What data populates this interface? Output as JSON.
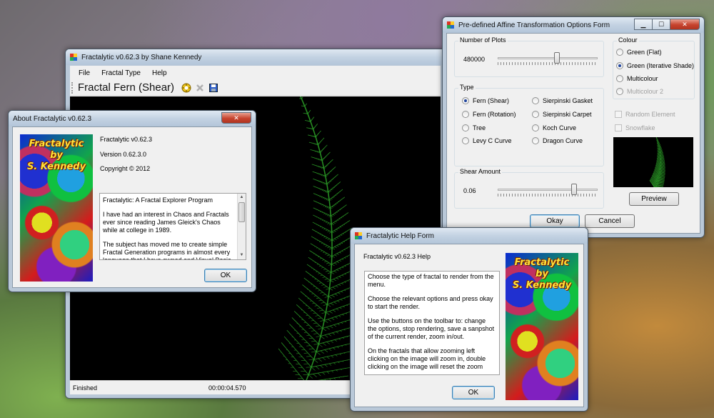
{
  "main_window": {
    "title": "Fractalytic v0.62.3 by Shane Kennedy",
    "menu": [
      "File",
      "Fractal Type",
      "Help"
    ],
    "fractal_label": "Fractal Fern (Shear)",
    "toolbar_icons": [
      "options-icon",
      "stop-icon",
      "save-icon"
    ],
    "status": {
      "left": "Finished",
      "time": "00:00:04.570"
    }
  },
  "about_window": {
    "title": "About Fractalytic v0.62.3",
    "image_caption": [
      "Fractalytic",
      "by",
      "S. Kennedy"
    ],
    "product": "Fractalytic v0.62.3",
    "version": "Version 0.62.3.0",
    "copyright": "Copyright © 2012",
    "description": [
      "Fractalytic: A Fractal Explorer Program",
      "I have had an interest in Chaos and Fractals ever since reading James Gleick's Chaos while at college in 1989.",
      "The subject has moved me to create simple Fractal Generation programs in almost every language that I have owned and Visual Basic is"
    ],
    "ok_label": "OK"
  },
  "options_window": {
    "title": "Pre-defined Affine Transformation Options Form",
    "plots": {
      "legend": "Number of Plots",
      "value": "480000",
      "level": 0.6
    },
    "type": {
      "legend": "Type",
      "options": [
        {
          "label": "Fern (Shear)",
          "selected": true
        },
        {
          "label": "Sierpinski Gasket",
          "selected": false
        },
        {
          "label": "Fern (Rotation)",
          "selected": false
        },
        {
          "label": "Sierpinski Carpet",
          "selected": false
        },
        {
          "label": "Tree",
          "selected": false
        },
        {
          "label": "Koch Curve",
          "selected": false
        },
        {
          "label": "Levy C Curve",
          "selected": false
        },
        {
          "label": "Dragon Curve",
          "selected": false
        }
      ]
    },
    "shear": {
      "legend": "Shear Amount",
      "value": "0.06",
      "level": 0.78
    },
    "colour": {
      "legend": "Colour",
      "options": [
        {
          "label": "Green (Flat)",
          "selected": false,
          "disabled": false
        },
        {
          "label": "Green (Iterative Shade)",
          "selected": true,
          "disabled": false
        },
        {
          "label": "Multicolour",
          "selected": false,
          "disabled": false
        },
        {
          "label": "Multicolour 2",
          "selected": false,
          "disabled": true
        }
      ]
    },
    "checks": [
      "Random Element",
      "Snowflake"
    ],
    "preview_label": "Preview",
    "okay_label": "Okay",
    "cancel_label": "Cancel"
  },
  "help_window": {
    "title": "Fractalytic Help Form",
    "heading": "Fractalytic v0.62.3 Help",
    "image_caption": [
      "Fractalytic",
      "by",
      "S. Kennedy"
    ],
    "paragraphs": [
      "Choose the type of fractal to render from the menu.",
      "Choose the relevant options and press okay to start the render.",
      "Use the buttons on the toolbar to: change the options, stop rendering, save a sanpshot of the current render, zoom in/out.",
      "On the fractals that allow zooming left clicking on the image will zoom in, double clicking on the image will reset the zoom"
    ],
    "ok_label": "OK"
  },
  "colors": {
    "fern_green": "#2fa82a",
    "canvas_bg": "#000000",
    "selected_radio": "#21469e"
  }
}
